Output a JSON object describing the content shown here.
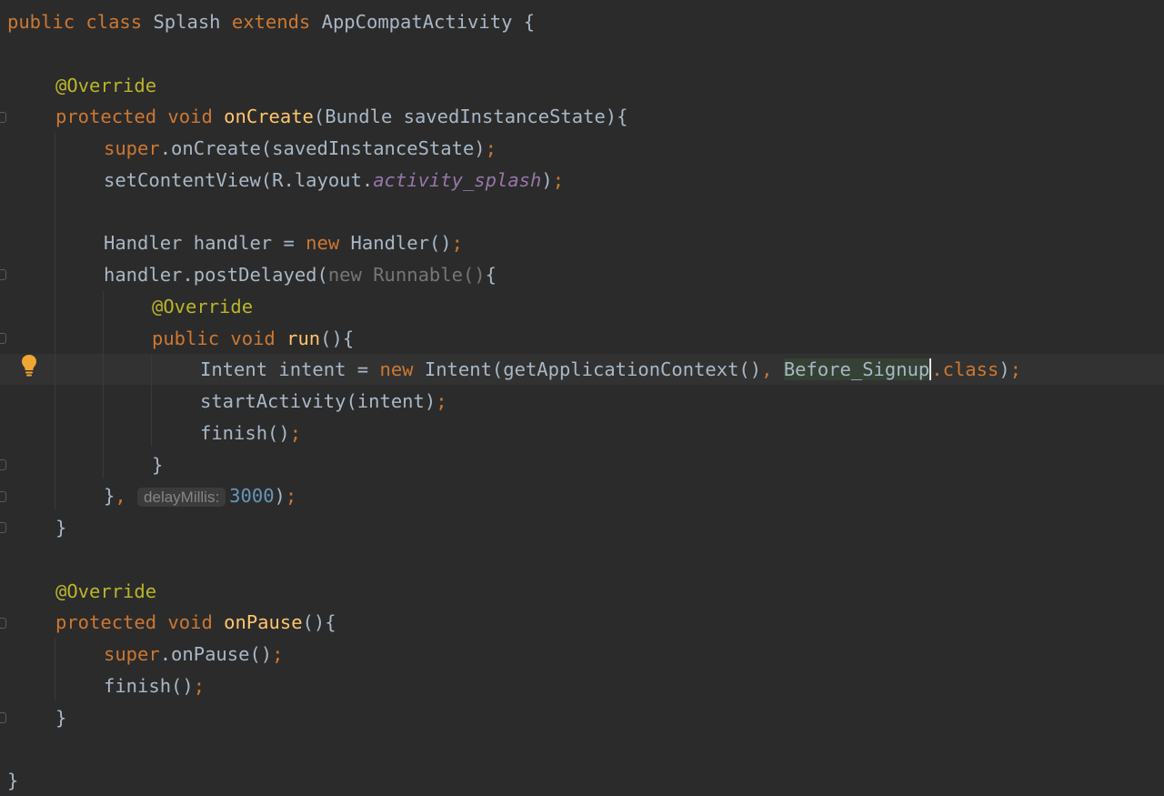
{
  "colors": {
    "background": "#2b2b2b",
    "keyword": "#cc7832",
    "text": "#a9b7c6",
    "annotation": "#bbb529",
    "method": "#ffc66d",
    "field": "#9876aa",
    "number": "#6897bb",
    "bulb": "#f0a732"
  },
  "icons": {
    "intention": "lightbulb-icon",
    "fold": "fold-marker-icon"
  },
  "editor": {
    "lines": [
      {
        "indent": 0,
        "tokens": [
          {
            "t": "public class ",
            "c": "kw"
          },
          {
            "t": "Splash ",
            "c": "txt"
          },
          {
            "t": "extends ",
            "c": "kw"
          },
          {
            "t": "AppCompatActivity {",
            "c": "txt"
          }
        ]
      },
      {
        "indent": 0,
        "tokens": []
      },
      {
        "indent": 1,
        "tokens": [
          {
            "t": "@Override",
            "c": "ann"
          }
        ]
      },
      {
        "indent": 1,
        "tokens": [
          {
            "t": "protected void ",
            "c": "kw"
          },
          {
            "t": "onCreate",
            "c": "fn"
          },
          {
            "t": "(Bundle savedInstanceState){",
            "c": "txt"
          }
        ]
      },
      {
        "indent": 2,
        "tokens": [
          {
            "t": "super",
            "c": "kw"
          },
          {
            "t": ".onCreate(savedInstanceState)",
            "c": "txt"
          },
          {
            "t": ";",
            "c": "kw"
          }
        ]
      },
      {
        "indent": 2,
        "tokens": [
          {
            "t": "setContentView(R.layout.",
            "c": "txt"
          },
          {
            "t": "activity_splash",
            "c": "field"
          },
          {
            "t": ")",
            "c": "txt"
          },
          {
            "t": ";",
            "c": "kw"
          }
        ]
      },
      {
        "indent": 0,
        "tokens": []
      },
      {
        "indent": 2,
        "tokens": [
          {
            "t": "Handler handler = ",
            "c": "txt"
          },
          {
            "t": "new ",
            "c": "kw"
          },
          {
            "t": "Handler()",
            "c": "txt"
          },
          {
            "t": ";",
            "c": "kw"
          }
        ]
      },
      {
        "indent": 2,
        "tokens": [
          {
            "t": "handler.postDelayed(",
            "c": "txt"
          },
          {
            "t": "new Runnable()",
            "c": "dim"
          },
          {
            "t": "{",
            "c": "txt"
          }
        ]
      },
      {
        "indent": 3,
        "tokens": [
          {
            "t": "@Override",
            "c": "ann"
          }
        ]
      },
      {
        "indent": 3,
        "tokens": [
          {
            "t": "public void ",
            "c": "kw"
          },
          {
            "t": "run",
            "c": "fn"
          },
          {
            "t": "(){",
            "c": "txt"
          }
        ]
      },
      {
        "indent": 4,
        "current": true,
        "tokens": [
          {
            "t": "Intent intent = ",
            "c": "txt"
          },
          {
            "t": "new ",
            "c": "kw"
          },
          {
            "t": "Intent(getApplicationContext()",
            "c": "txt"
          },
          {
            "t": ", ",
            "c": "kw"
          },
          {
            "t": "Before_Signup",
            "c": "hl"
          },
          {
            "t": "",
            "c": "caret"
          },
          {
            "t": ".class",
            "c": "kw"
          },
          {
            "t": ")",
            "c": "txt"
          },
          {
            "t": ";",
            "c": "kw"
          }
        ]
      },
      {
        "indent": 4,
        "tokens": [
          {
            "t": "startActivity(intent)",
            "c": "txt"
          },
          {
            "t": ";",
            "c": "kw"
          }
        ]
      },
      {
        "indent": 4,
        "tokens": [
          {
            "t": "finish()",
            "c": "txt"
          },
          {
            "t": ";",
            "c": "kw"
          }
        ]
      },
      {
        "indent": 3,
        "tokens": [
          {
            "t": "}",
            "c": "txt"
          }
        ]
      },
      {
        "indent": 2,
        "tokens": [
          {
            "t": "}",
            "c": "txt"
          },
          {
            "t": ", ",
            "c": "kw"
          },
          {
            "t": "delayMillis:",
            "c": "hint"
          },
          {
            "t": "3000",
            "c": "num"
          },
          {
            "t": ")",
            "c": "txt"
          },
          {
            "t": ";",
            "c": "kw"
          }
        ]
      },
      {
        "indent": 1,
        "tokens": [
          {
            "t": "}",
            "c": "txt"
          }
        ]
      },
      {
        "indent": 0,
        "tokens": []
      },
      {
        "indent": 1,
        "tokens": [
          {
            "t": "@Override",
            "c": "ann"
          }
        ]
      },
      {
        "indent": 1,
        "tokens": [
          {
            "t": "protected void ",
            "c": "kw"
          },
          {
            "t": "onPause",
            "c": "fn"
          },
          {
            "t": "(){",
            "c": "txt"
          }
        ]
      },
      {
        "indent": 2,
        "tokens": [
          {
            "t": "super",
            "c": "kw"
          },
          {
            "t": ".onPause()",
            "c": "txt"
          },
          {
            "t": ";",
            "c": "kw"
          }
        ]
      },
      {
        "indent": 2,
        "tokens": [
          {
            "t": "finish()",
            "c": "txt"
          },
          {
            "t": ";",
            "c": "kw"
          }
        ]
      },
      {
        "indent": 1,
        "tokens": [
          {
            "t": "}",
            "c": "txt"
          }
        ]
      },
      {
        "indent": 0,
        "tokens": []
      },
      {
        "indent": 0,
        "tokens": [
          {
            "t": "}",
            "c": "txt"
          }
        ]
      }
    ]
  }
}
